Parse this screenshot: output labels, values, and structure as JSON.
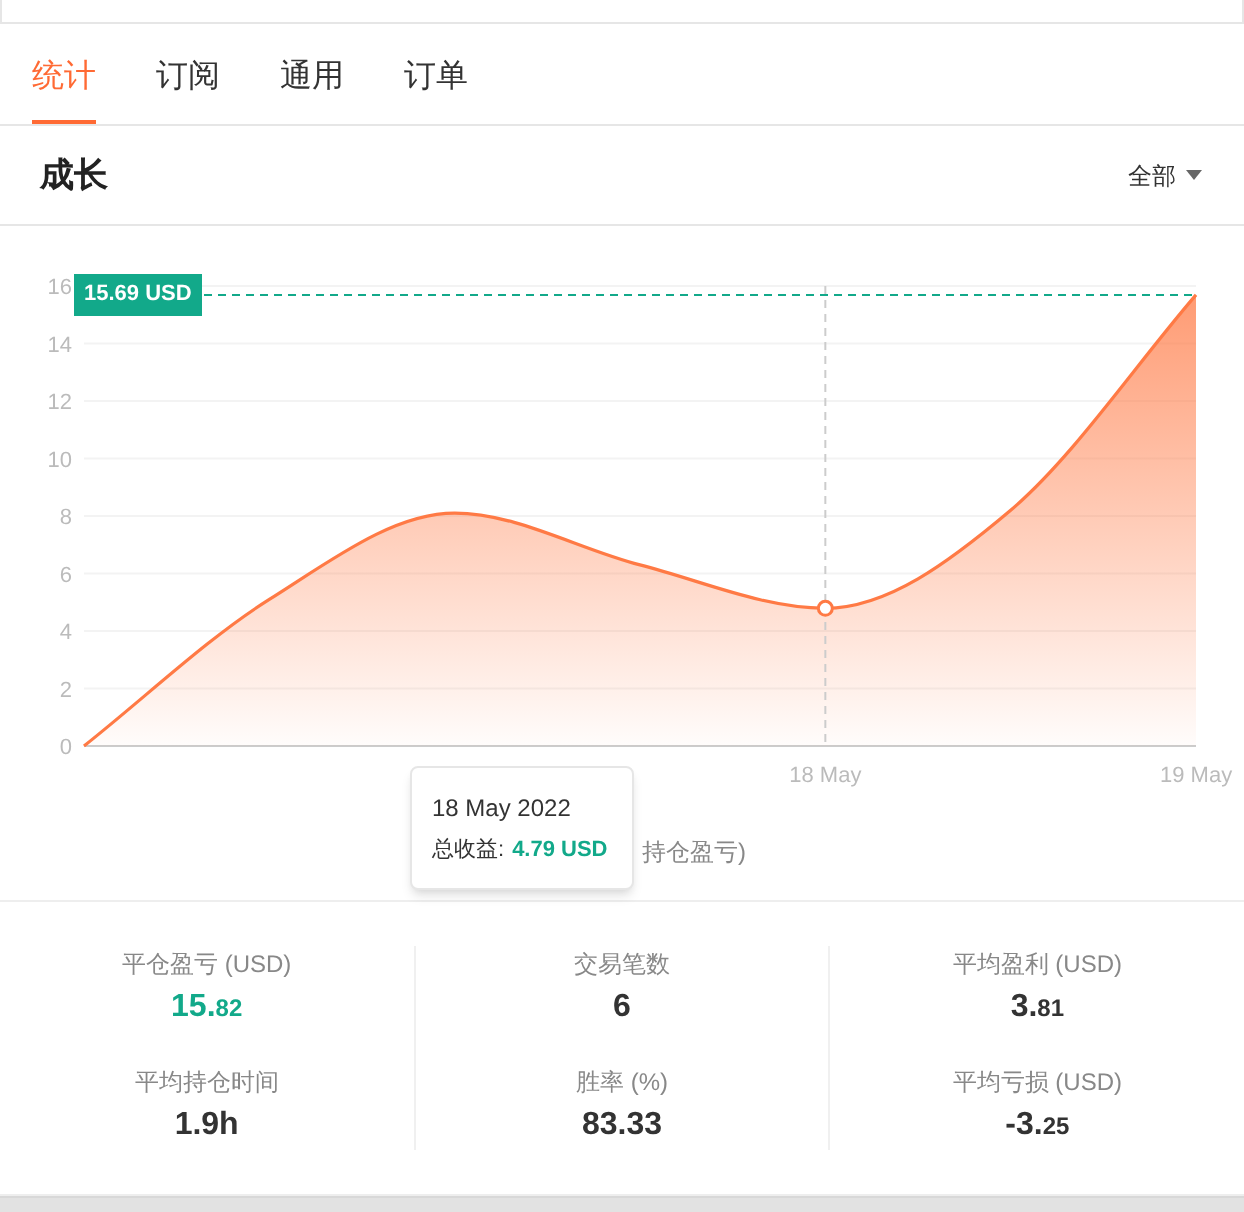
{
  "tabs": [
    {
      "label": "统计",
      "selected": true
    },
    {
      "label": "订阅",
      "selected": false
    },
    {
      "label": "通用",
      "selected": false
    },
    {
      "label": "订单",
      "selected": false
    }
  ],
  "section": {
    "title": "成长",
    "filter": "全部"
  },
  "chart": {
    "legend_fragment": "持仓盈亏)",
    "tooltip": {
      "date": "18 May 2022",
      "label": "总收益:",
      "value": "4.79 USD"
    },
    "chart_data": {
      "type": "area",
      "categories": [
        null,
        null,
        null,
        null,
        "18 May",
        null,
        "19 May"
      ],
      "grid": true,
      "ref_lines": [
        {
          "axis": "y",
          "value": 15.69,
          "label": "15.69 USD",
          "color": "#12a98a"
        }
      ],
      "series": [
        {
          "color": "#ff7a45",
          "values": [
            0,
            5.1,
            8.1,
            6.3,
            4.79,
            8.2,
            15.69
          ]
        }
      ],
      "ylim": [
        0,
        16
      ],
      "yticks": [
        0,
        2,
        4,
        6,
        8,
        10,
        12,
        14,
        16
      ]
    }
  },
  "stats": [
    {
      "label": "平仓盈亏 (USD)",
      "int": "15.",
      "dec": "82",
      "highlighted": true
    },
    {
      "label": "交易笔数",
      "int": "6",
      "highlighted": false
    },
    {
      "label": "平均盈利 (USD)",
      "int": "3.",
      "dec": "81",
      "highlighted": false
    },
    {
      "label": "平均持仓时间",
      "int": "1.9h",
      "highlighted": false
    },
    {
      "label": "胜率 (%)",
      "int": "83.33",
      "highlighted": false
    },
    {
      "label": "平均亏损 (USD)",
      "int": "-3.",
      "dec": "25",
      "highlighted": false
    }
  ]
}
